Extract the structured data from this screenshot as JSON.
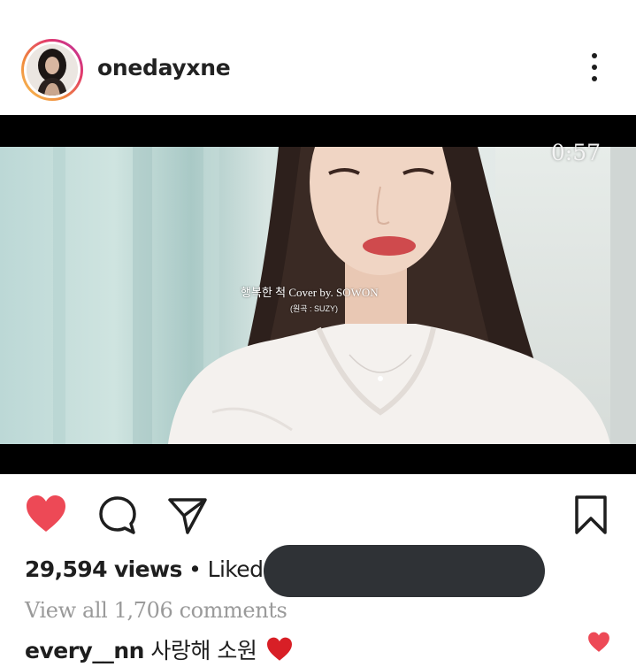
{
  "post": {
    "username": "onedayxne",
    "video": {
      "duration": "0:57",
      "subtitle_main": "행복한 척 Cover by. SOWON",
      "subtitle_sub": "(원곡 : SUZY)"
    },
    "actions": {
      "like": "heart-icon",
      "comment": "comment-icon",
      "share": "share-icon",
      "save": "bookmark-icon",
      "liked": true
    },
    "stats": {
      "views": "29,594 views",
      "separator": " • ",
      "liked_by": "Liked by"
    },
    "comments_link": "View all 1,706 comments",
    "top_comment": {
      "author": "every__nn",
      "text": " 사랑해 소원"
    }
  },
  "colors": {
    "heart": "#ed4956",
    "text": "#1e1e1e",
    "muted": "#9a9a9a",
    "redaction": "#2f3236"
  }
}
